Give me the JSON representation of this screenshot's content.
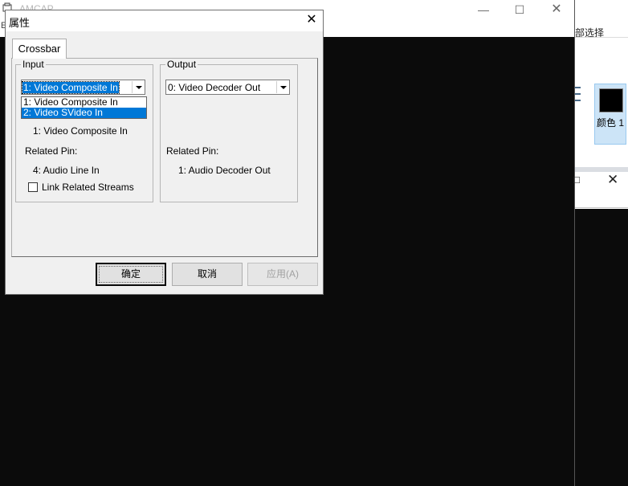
{
  "background_window": {
    "title": "AMCAP",
    "menu_fragment": "E",
    "controls": {
      "minimize": "—",
      "maximize": "☐",
      "close": "✕"
    }
  },
  "ribbon": {
    "select_label": "部选择",
    "color1_label": "颜色 1",
    "color1_value": "#000000",
    "close_fragment": "□",
    "close": "✕"
  },
  "dialog": {
    "title": "属性",
    "close": "✕",
    "tabs": [
      {
        "label": "Crossbar"
      }
    ],
    "input": {
      "group_title": "Input",
      "combo_value": "1: Video Composite In",
      "options": [
        "1: Video Composite In",
        "2: Video SVideo In"
      ],
      "highlighted_option": "2: Video SVideo In",
      "current": "1: Video Composite In",
      "related_label": "Related Pin:",
      "related_pin": "4: Audio Line In",
      "link_label": "Link Related Streams",
      "link_checked": false
    },
    "output": {
      "group_title": "Output",
      "combo_value": "0: Video Decoder Out",
      "related_label": "Related Pin:",
      "related_pin": "1: Audio Decoder Out"
    },
    "buttons": {
      "ok": "确定",
      "cancel": "取消",
      "apply": "应用(A)"
    }
  }
}
